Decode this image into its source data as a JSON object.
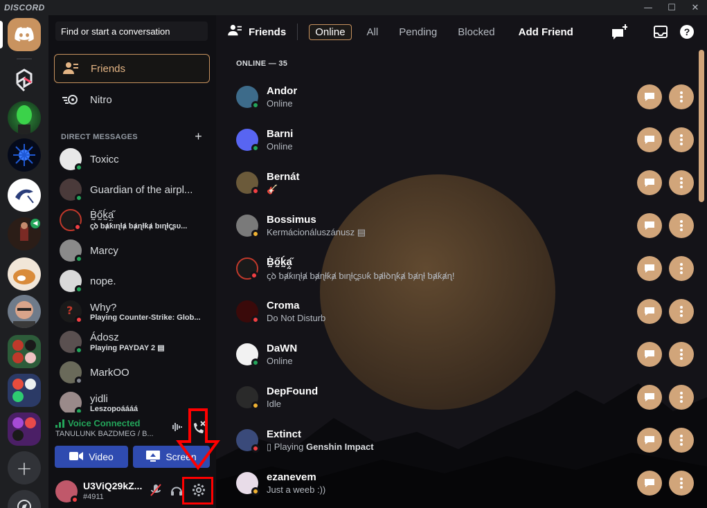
{
  "app": {
    "brand": "DISCORD"
  },
  "window_controls": {
    "minimize": "—",
    "maximize": "☐",
    "close": "✕"
  },
  "colors": {
    "accent": "#c9935f",
    "online": "#23a55a",
    "dnd": "#f23f43",
    "idle": "#f0b232",
    "voice_blue": "#2f4bb0",
    "annotation": "#ff0000"
  },
  "servers": [
    {
      "name": "home",
      "icon": "discord-logo-icon"
    },
    {
      "name": "server-red-logo",
      "icon": "red-geometric-logo-icon"
    },
    {
      "name": "server-alien",
      "icon": "green-alien-icon"
    },
    {
      "name": "server-blue-burst",
      "icon": "blue-burst-icon"
    },
    {
      "name": "server-kali",
      "icon": "dragon-icon"
    },
    {
      "name": "server-voice",
      "icon": "speaker-icon"
    },
    {
      "name": "server-fox",
      "icon": "fox-icon"
    },
    {
      "name": "server-face",
      "icon": "face-avatar-icon"
    },
    {
      "name": "server-folder-1",
      "icon": "folder-icon"
    },
    {
      "name": "server-folder-2",
      "icon": "folder-icon"
    },
    {
      "name": "server-folder-3",
      "icon": "folder-icon"
    },
    {
      "name": "add-server",
      "icon": "plus-icon"
    },
    {
      "name": "explore",
      "icon": "compass-icon"
    }
  ],
  "search": {
    "label": "Find or start a conversation"
  },
  "nav": {
    "friends": "Friends",
    "nitro": "Nitro"
  },
  "dm_header": {
    "label": "DIRECT MESSAGES",
    "add": "+"
  },
  "dms": [
    {
      "name": "Toxicc",
      "sub": "",
      "status": "online"
    },
    {
      "name": "Guardian of the airpl...",
      "sub": "",
      "status": "online"
    },
    {
      "name": "Ḃ̰ő̰ḱ̰ạ̰̋",
      "sub": "ꞔꝺ ƅⱥƙιɳƚⱥ ƅⱥɳƚƙⱥ ƅιɳƚꞔʂυ...",
      "status": "dnd"
    },
    {
      "name": "Marcy",
      "sub": "",
      "status": "online"
    },
    {
      "name": "nope.",
      "sub": "",
      "status": "online"
    },
    {
      "name": "Why?",
      "sub": "Playing Counter-Strike: Glob...",
      "status": "dnd"
    },
    {
      "name": "Ádosz",
      "sub": "Playing PAYDAY 2 ▤",
      "status": "online"
    },
    {
      "name": "MarkOO",
      "sub": "",
      "status": "offline"
    },
    {
      "name": "yidli",
      "sub": "Leszopoáááá",
      "status": "online"
    }
  ],
  "voice": {
    "status": "Voice Connected",
    "channel": "TANULUNK BAZDMEG / B...",
    "video": "Video",
    "screen": "Screen"
  },
  "user": {
    "name": "U3ViQ29kZ...",
    "tag": "#4911"
  },
  "topbar": {
    "title": "Friends",
    "tabs": [
      "Online",
      "All",
      "Pending",
      "Blocked"
    ],
    "add_friend": "Add Friend"
  },
  "online_header": "ONLINE — 35",
  "friends": [
    {
      "name": "Andor",
      "sub": "Online",
      "status": "online"
    },
    {
      "name": "Barni",
      "sub": "Online",
      "status": "online"
    },
    {
      "name": "Bernát",
      "sub": "🎸",
      "status": "dnd"
    },
    {
      "name": "Bossimus",
      "sub": "Kermácionáluszánusz ▤",
      "status": "idle"
    },
    {
      "name": "Ḃ̰ő̰ḱ̰ạ̰̋",
      "sub": "ꞔꝺ ƅⱥƙιɳƚⱥ ƅⱥɳƚƙⱥ ƅιɳƚꞔʂυƙ ƅⱥƚꝺɳƙⱥ ƅⱥɳƚ ƅⱥƙⱥɳ!",
      "status": "dnd"
    },
    {
      "name": "Croma",
      "sub": "Do Not Disturb",
      "status": "dnd"
    },
    {
      "name": "DaWN",
      "sub": "Online",
      "status": "online"
    },
    {
      "name": "DepFound",
      "sub": "Idle",
      "status": "idle"
    },
    {
      "name": "Extinct",
      "sub_prefix": "Playing ",
      "sub_game": "Genshin Impact",
      "sub": "",
      "status": "dnd"
    },
    {
      "name": "ezanevem",
      "sub": "Just a weeb :))",
      "status": "idle"
    }
  ]
}
